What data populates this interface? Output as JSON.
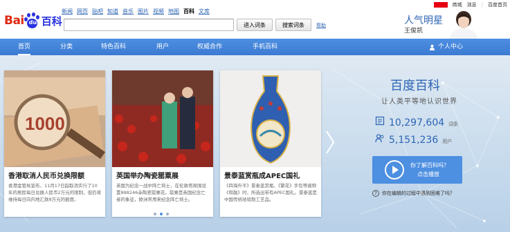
{
  "logo": {
    "bai": "Bai",
    "du": "du",
    "baike": "百科"
  },
  "nav_links": [
    {
      "label": "新闻",
      "active": false
    },
    {
      "label": "网页",
      "active": false
    },
    {
      "label": "贴吧",
      "active": false
    },
    {
      "label": "知道",
      "active": false
    },
    {
      "label": "音乐",
      "active": false
    },
    {
      "label": "图片",
      "active": false
    },
    {
      "label": "视频",
      "active": false
    },
    {
      "label": "地图",
      "active": false
    },
    {
      "label": "百科",
      "active": true
    },
    {
      "label": "文库",
      "active": false
    }
  ],
  "search": {
    "value": "",
    "enter_label": "进入词条",
    "search_label": "搜索词条",
    "help_label": "帮助"
  },
  "topright": {
    "mall": "商城",
    "message": "消息",
    "home": "百度首页"
  },
  "star": {
    "title": "人气明星",
    "name": "王俊凯"
  },
  "navbar": {
    "items": [
      "首页",
      "分类",
      "特色百科",
      "用户",
      "权威合作",
      "手机百科"
    ],
    "personal": "个人中心"
  },
  "cards": [
    {
      "title": "香港取消人民币兑换限额",
      "desc": "香港金管局宣布，11月17日起取消实行了10年的居民每日兑换人民币2万元的限制，但仍将维持每日向内地汇款8万元的额度。"
    },
    {
      "title": "英国举办陶瓷罂粟展",
      "desc": "英国为纪念一战中阵亡将士，在伦敦塔周围设置888246朵陶瓷罂粟花。罂粟是英国纪念亡者的象征，欧洲常用来纪念阵亡将士。"
    },
    {
      "title": "景泰蓝赏瓶成APEC国礼",
      "desc": "《四海升平》景泰蓝赏瓶、《繁花》手包等被称《和融》时，所选出带有APEC国礼。景泰蓝是中国传统珐琅制工艺品。"
    }
  ],
  "right": {
    "title": "百度百科",
    "slogan": "让人类平等地认识世界",
    "entries_count": "10,297,604",
    "entries_unit": "词条",
    "users_count": "5,151,236",
    "users_unit": "用户",
    "know_q": "你了解百科吗？",
    "know_play": "点击播放",
    "trouble": "你在编辑的过程中遇到困难了吗？"
  },
  "colors": {
    "accent": "#4d8fe1",
    "brand_red": "#de2810",
    "brand_blue": "#2932e1",
    "link": "#2d64b3"
  },
  "carousel": {
    "total_pages": 3,
    "current_page": 2
  }
}
